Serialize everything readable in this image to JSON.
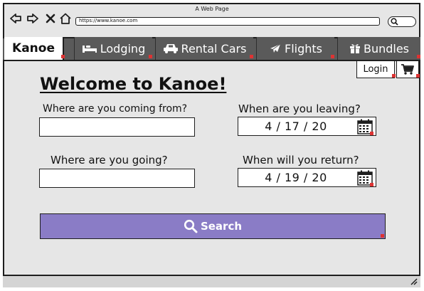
{
  "window": {
    "title": "A Web Page"
  },
  "browser": {
    "url": "https://www.kanoe.com"
  },
  "tabs": [
    {
      "label": "Kanoe",
      "icon": ""
    },
    {
      "label": "Lodging",
      "icon": "bed-icon"
    },
    {
      "label": "Rental Cars",
      "icon": "car-icon"
    },
    {
      "label": "Flights",
      "icon": "plane-icon"
    },
    {
      "label": "Bundles",
      "icon": "gift-icon"
    }
  ],
  "header": {
    "login_label": "Login",
    "cart_icon": "cart-icon"
  },
  "main": {
    "title": "Welcome to Kanoe!",
    "from_label": "Where are you coming from?",
    "from_value": "",
    "to_label": "Where are you going?",
    "to_value": "",
    "leave_label": "When are you leaving?",
    "leave_date": "4 / 17 / 20",
    "return_label": "When will you return?",
    "return_date": "4 / 19 / 20",
    "search_label": "Search"
  },
  "colors": {
    "accent": "#8a7cc6",
    "tabbar": "#5a5a5a",
    "background": "#e6e6e6"
  }
}
